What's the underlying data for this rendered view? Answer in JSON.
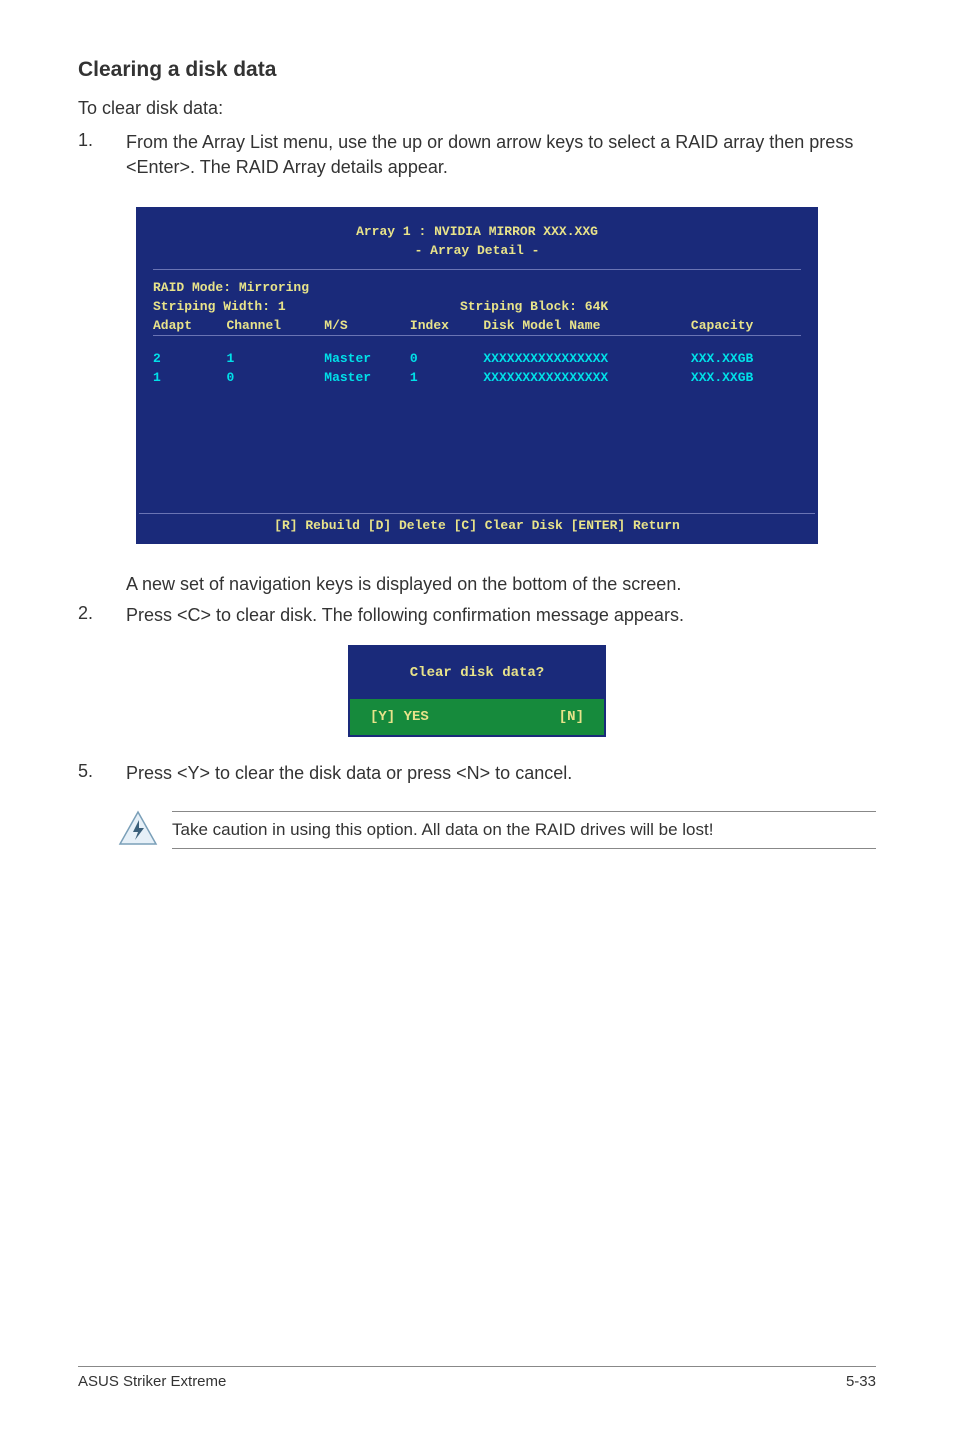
{
  "heading": "Clearing a disk data",
  "intro": "To clear disk data:",
  "step1_num": "1.",
  "step1_text": "From the Array List menu, use the up or down arrow keys to select a RAID array then press <Enter>. The RAID Array details appear.",
  "bios": {
    "title_line1": "Array 1 : NVIDIA MIRROR  XXX.XXG",
    "title_line2": "- Array Detail -",
    "mode_label": "RAID Mode: Mirroring",
    "stripe_width": "Striping Width: 1",
    "stripe_block": "Striping Block: 64K",
    "headers": {
      "adapt": "Adapt",
      "channel": "Channel",
      "ms": "M/S",
      "index": "Index",
      "model": "Disk Model Name",
      "capacity": "Capacity"
    },
    "rows": [
      {
        "adapt": "2",
        "channel": "1",
        "ms": "Master",
        "index": "0",
        "model": "XXXXXXXXXXXXXXXX",
        "capacity": "XXX.XXGB"
      },
      {
        "adapt": "1",
        "channel": "0",
        "ms": "Master",
        "index": "1",
        "model": "XXXXXXXXXXXXXXXX",
        "capacity": "XXX.XXGB"
      }
    ],
    "footer": "[R] Rebuild  [D] Delete  [C] Clear Disk  [ENTER] Return"
  },
  "after_bios": "A new set of  navigation keys is displayed on the bottom of the screen.",
  "step2_num": "2.",
  "step2_text": "Press <C> to clear disk. The following confirmation message appears.",
  "dialog": {
    "question": "Clear disk data?",
    "yes": "[Y] YES",
    "no": "[N]"
  },
  "step5_num": "5.",
  "step5_text": "Press <Y> to clear the disk data or press <N> to cancel.",
  "caution": "Take caution in using this option. All data on the RAID drives will be lost!",
  "footer_left": "ASUS Striker Extreme",
  "footer_right": "5-33"
}
